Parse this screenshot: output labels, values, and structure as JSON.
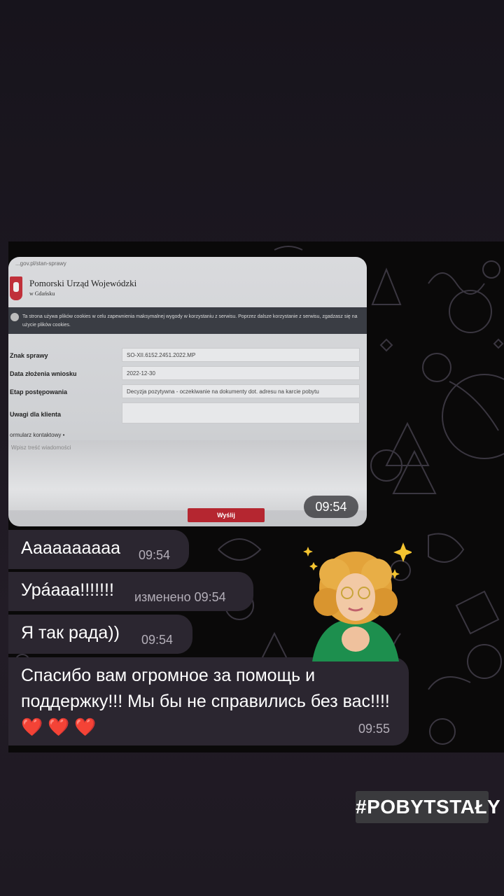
{
  "document_photo": {
    "url": "...gov.pl/stan-sprawy",
    "org_title": "Pomorski Urząd Wojewódzki",
    "org_subtitle": "w Gdańsku",
    "cookie_notice": "Ta strona używa plików cookies w celu zapewnienia maksymalnej wygody w korzystaniu z serwisu. Poprzez dalsze korzystanie z serwisu, zgadzasz się na użycie plików cookies.",
    "rows": [
      {
        "label": "Znak sprawy",
        "value": "SO-XII.6152.2451.2022.MP"
      },
      {
        "label": "Data złożenia wniosku",
        "value": "2022-12-30"
      },
      {
        "label": "Etap postępowania",
        "value": "Decyzja pozytywna - oczekiwanie na dokumenty dot. adresu na karcie pobytu"
      },
      {
        "label": "Uwagi dla klienta",
        "value": ""
      }
    ],
    "form_label": "ormularz kontaktowy •",
    "message_placeholder": "Wpisz treść wiadomości",
    "send_button": "Wyślij",
    "time": "09:54"
  },
  "messages": [
    {
      "text": "Аааааааааа",
      "time": "09:54"
    },
    {
      "text": "Урáааа!!!!!!!",
      "time": "изменено 09:54"
    },
    {
      "text": "Я так рада))",
      "time": "09:54"
    },
    {
      "text": "Спасибо вам огромное за помощь и поддержку!!! Мы бы не справились без вас!!!!",
      "hearts": "❤️ ❤️ ❤️",
      "time": "09:55"
    }
  ],
  "sticker": "memoji-hands-on-heart",
  "hashtag": "#POBYTSTAŁY",
  "colors": {
    "background": "#1d1821",
    "chat_background": "#0a0909",
    "bubble": "#2b2630",
    "send_button": "#b52630",
    "heart": "#e0222b"
  }
}
